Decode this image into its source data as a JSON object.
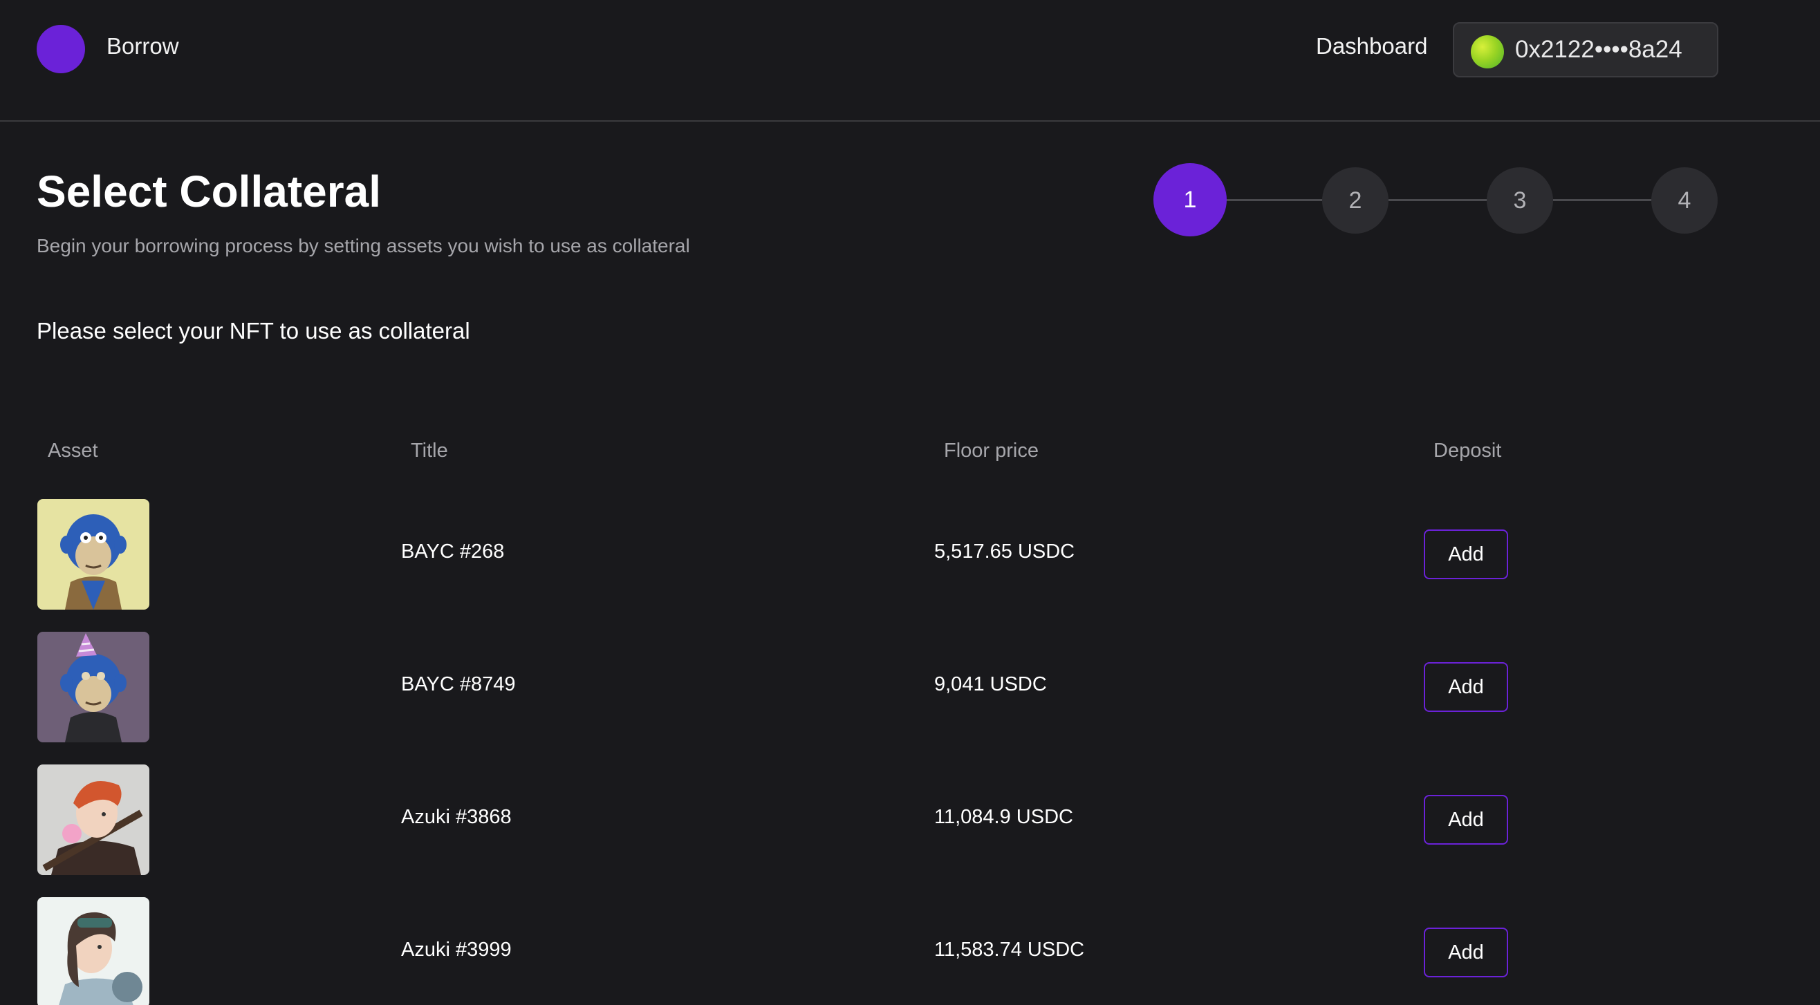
{
  "header": {
    "brand": "Borrow",
    "nav_dashboard": "Dashboard",
    "wallet_address": "0x2122••••8a24"
  },
  "main": {
    "title": "Select Collateral",
    "subtitle": "Begin your borrowing process by setting assets you wish to use as collateral",
    "instruction": "Please select your NFT to use as collateral",
    "steps": [
      "1",
      "2",
      "3",
      "4"
    ],
    "active_step": 1
  },
  "table": {
    "headers": {
      "asset": "Asset",
      "title": "Title",
      "floor_price": "Floor price",
      "deposit": "Deposit"
    },
    "rows": [
      {
        "title": "BAYC #268",
        "floor_price": "5,517.65 USDC",
        "action": "Add"
      },
      {
        "title": "BAYC #8749",
        "floor_price": "9,041 USDC",
        "action": "Add"
      },
      {
        "title": "Azuki #3868",
        "floor_price": "11,084.9 USDC",
        "action": "Add"
      },
      {
        "title": "Azuki #3999",
        "floor_price": "11,583.74 USDC",
        "action": "Add"
      }
    ]
  },
  "colors": {
    "background": "#19191c",
    "accent": "#6b22d8",
    "muted_text": "#a6a6ab"
  },
  "icons": {
    "logo": "purple-circle-logo",
    "wallet_avatar": "green-gradient-avatar"
  }
}
